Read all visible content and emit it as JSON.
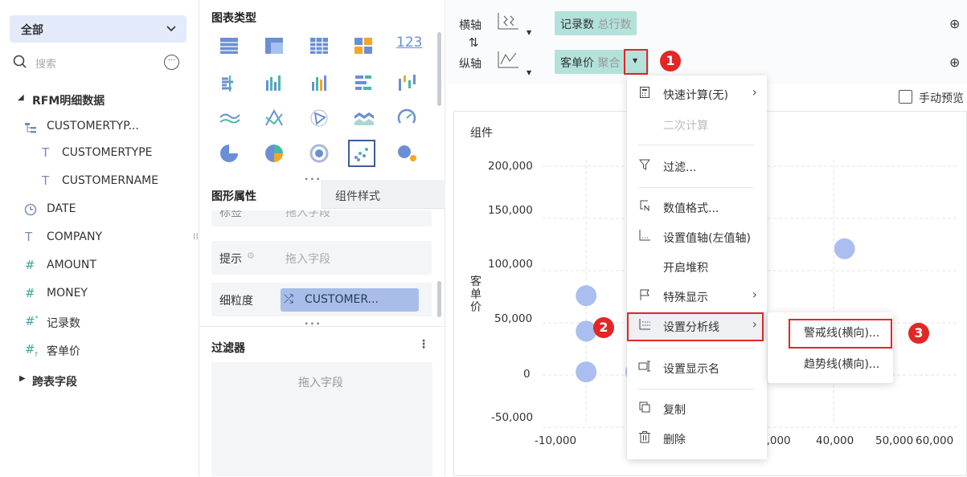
{
  "left": {
    "scope": "全部",
    "search_placeholder": "搜索",
    "more_icon": "more-circle-icon",
    "tree": [
      {
        "label": "RFM明细数据",
        "icon": "caret-down-icon",
        "bold": true
      },
      {
        "label": "CUSTOMERTYP...",
        "icon": "hierarchy-icon"
      },
      {
        "label": "CUSTOMERTYPE",
        "icon": "text-field-icon"
      },
      {
        "label": "CUSTOMERNAME",
        "icon": "text-field-icon"
      },
      {
        "label": "DATE",
        "icon": "clock-icon"
      },
      {
        "label": "COMPANY",
        "icon": "text-field-icon"
      },
      {
        "label": "AMOUNT",
        "icon": "number-field-icon"
      },
      {
        "label": "MONEY",
        "icon": "number-field-icon"
      },
      {
        "label": "记录数",
        "icon": "count-field-icon"
      },
      {
        "label": "客单价",
        "icon": "calc-field-icon"
      },
      {
        "label": "跨表字段",
        "icon": "caret-right-icon",
        "bold": true
      }
    ]
  },
  "mid": {
    "chart_type_title": "图表类型",
    "chart_type_123": "123",
    "props_tab": "图形属性",
    "style_tab": "组件样式",
    "prop_label_partial": "标签",
    "prop_label_value": "拖入字段",
    "prop_tip": "提示",
    "prop_tip_value": "拖入字段",
    "prop_grain": "细粒度",
    "prop_grain_value": "CUSTOMER...",
    "filter_title": "过滤器",
    "filter_placeholder": "拖入字段"
  },
  "axes": {
    "h_label": "横轴",
    "v_label": "纵轴",
    "h_pill": "记录数",
    "h_pill_agg": "总行数",
    "v_pill": "客单价",
    "v_pill_agg": "聚合",
    "manual_preview": "手动预览"
  },
  "chart": {
    "component_title": "组件",
    "y_label": "客单价",
    "y_ticks": [
      "200,000",
      "150,000",
      "100,000",
      "50,000",
      "0",
      "-50,000"
    ],
    "x_ticks": [
      "-10,000",
      "0,000",
      "40,000",
      "50,000",
      "60,000"
    ]
  },
  "chart_data": {
    "type": "scatter",
    "ylabel": "客单价",
    "ylim": [
      -50000,
      200000
    ],
    "grid": true,
    "points": [
      {
        "x": -5000,
        "y": 76000
      },
      {
        "x": -5000,
        "y": 42000
      },
      {
        "x": -5000,
        "y": 3000
      },
      {
        "x": 42000,
        "y": 121000
      }
    ]
  },
  "menu": {
    "items": [
      {
        "label": "快速计算(无)",
        "submenu": true
      },
      {
        "label": "二次计算",
        "disabled": true
      },
      {
        "label": "过滤..."
      },
      {
        "label": "数值格式..."
      },
      {
        "label": "设置值轴(左值轴)"
      },
      {
        "label": "开启堆积"
      },
      {
        "label": "特殊显示",
        "submenu": true
      },
      {
        "label": "设置分析线",
        "submenu": true
      },
      {
        "label": "设置显示名"
      },
      {
        "label": "复制"
      },
      {
        "label": "删除"
      }
    ],
    "submenu": [
      "警戒线(横向)...",
      "趋势线(横向)..."
    ]
  },
  "badges": [
    "1",
    "2",
    "3"
  ],
  "colors": {
    "accent": "#3e7bfa",
    "pill": "#b3e2db",
    "badge": "#e32626",
    "point": "#aabff0"
  }
}
